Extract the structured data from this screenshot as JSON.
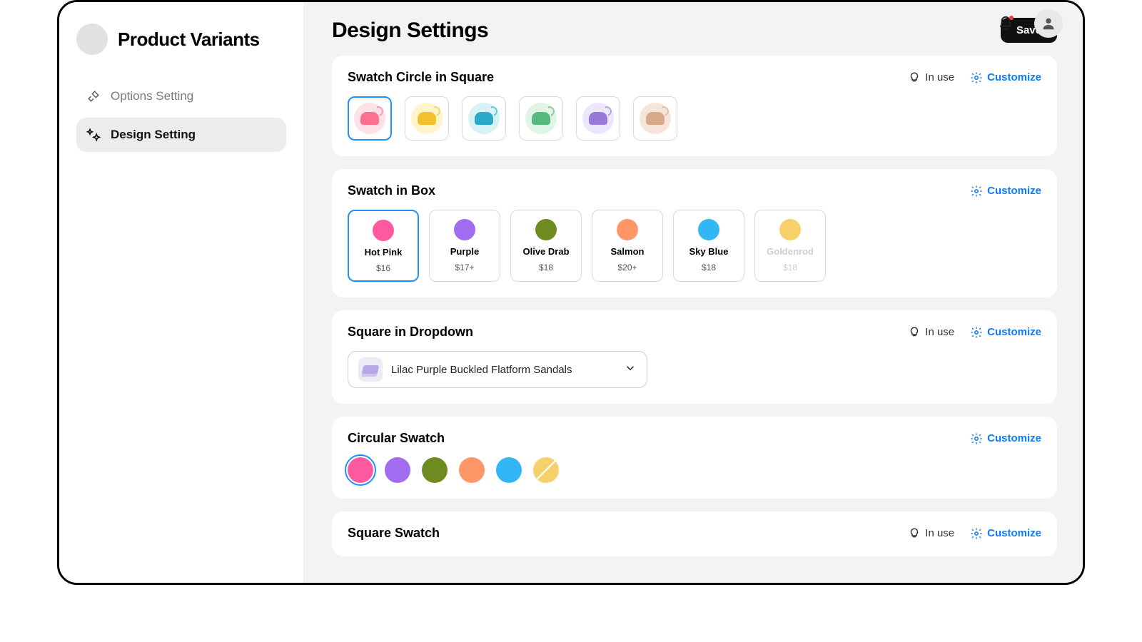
{
  "brand": {
    "title": "Product Variants"
  },
  "nav": {
    "items": [
      {
        "label": "Options Setting",
        "active": false
      },
      {
        "label": "Design Setting",
        "active": true
      }
    ]
  },
  "page": {
    "title": "Design Settings",
    "save_label": "Save"
  },
  "actions": {
    "in_use_label": "In use",
    "customize_label": "Customize"
  },
  "cards": {
    "circle_in_square": {
      "title": "Swatch Circle in Square",
      "in_use": true,
      "swatches": [
        {
          "bg": "#ffe1e6",
          "fg": "#ff6f91",
          "selected": true
        },
        {
          "bg": "#fff5cc",
          "fg": "#f3c22b",
          "selected": false
        },
        {
          "bg": "#d8f3f5",
          "fg": "#2aa9c9",
          "selected": false
        },
        {
          "bg": "#dff5e5",
          "fg": "#57b97d",
          "selected": false
        },
        {
          "bg": "#ede7fb",
          "fg": "#9679d8",
          "selected": false
        },
        {
          "bg": "#f6e5db",
          "fg": "#d8a88a",
          "selected": false
        }
      ]
    },
    "swatch_in_box": {
      "title": "Swatch in Box",
      "in_use": false,
      "items": [
        {
          "name": "Hot Pink",
          "price": "$16",
          "color": "#ff5aa0",
          "selected": true,
          "muted": false
        },
        {
          "name": "Purple",
          "price": "$17+",
          "color": "#a26cf0",
          "selected": false,
          "muted": false
        },
        {
          "name": "Olive Drab",
          "price": "$18",
          "color": "#6e8b1f",
          "selected": false,
          "muted": false
        },
        {
          "name": "Salmon",
          "price": "$20+",
          "color": "#ff9666",
          "selected": false,
          "muted": false
        },
        {
          "name": "Sky Blue",
          "price": "$18",
          "color": "#33b6f5",
          "selected": false,
          "muted": false
        },
        {
          "name": "Goldenrod",
          "price": "$18",
          "color": "#f6d06a",
          "selected": false,
          "muted": true
        }
      ]
    },
    "square_in_dropdown": {
      "title": "Square in Dropdown",
      "in_use": true,
      "selected_label": "Lilac Purple Buckled Flatform Sandals"
    },
    "circular_swatch": {
      "title": "Circular Swatch",
      "in_use": false,
      "items": [
        {
          "color": "#ff5aa0",
          "selected": true,
          "barred": false
        },
        {
          "color": "#a26cf0",
          "selected": false,
          "barred": false
        },
        {
          "color": "#6e8b1f",
          "selected": false,
          "barred": false
        },
        {
          "color": "#ff9666",
          "selected": false,
          "barred": false
        },
        {
          "color": "#33b6f5",
          "selected": false,
          "barred": false
        },
        {
          "color": "#f6d06a",
          "selected": false,
          "barred": true
        }
      ]
    },
    "square_swatch": {
      "title": "Square Swatch",
      "in_use": true
    }
  }
}
